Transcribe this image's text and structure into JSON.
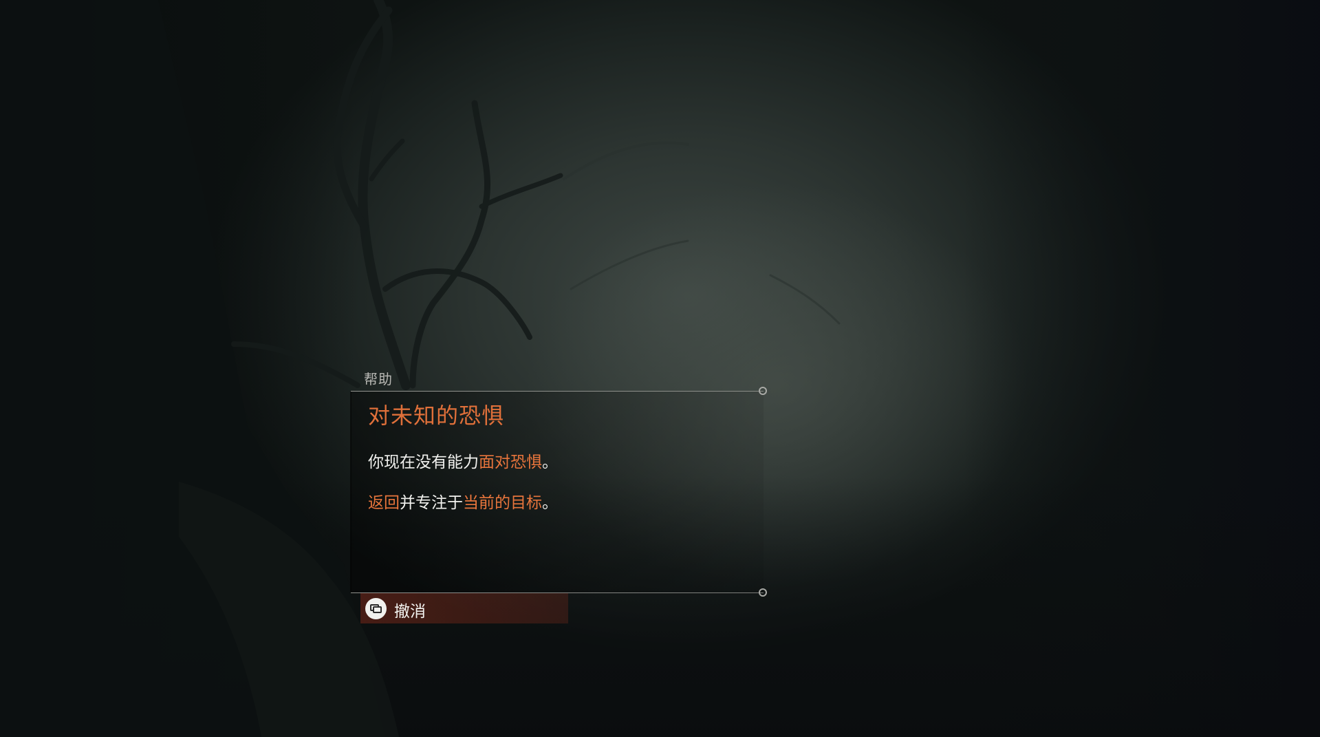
{
  "dialog": {
    "header": "帮助",
    "title": "对未知的恐惧",
    "line1": {
      "before": "你现在没有能力",
      "highlight": "面对恐惧",
      "after": "。"
    },
    "line2": {
      "highlight1": "返回",
      "middle": "并专注于",
      "highlight2": "当前的目标",
      "after": "。"
    },
    "cancel_label": "撤消",
    "cancel_icon": "touchpad-button-icon"
  },
  "colors": {
    "accent": "#e0703a",
    "text": "#f2f2ef",
    "header_text": "#b8b8b4",
    "cancel_bar": "#78281a"
  }
}
